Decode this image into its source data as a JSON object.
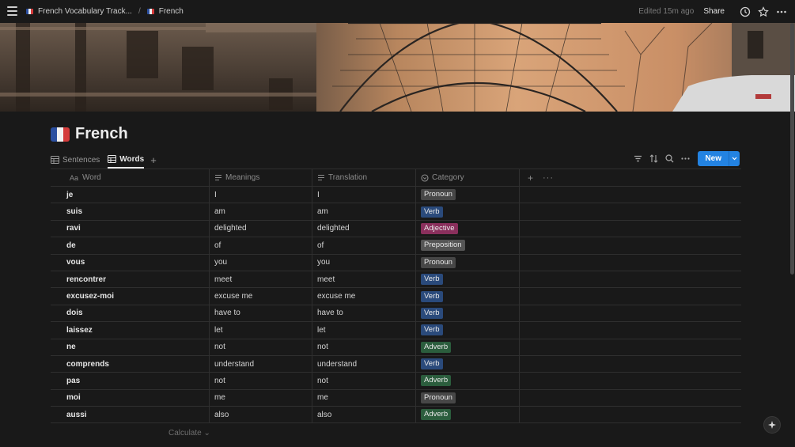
{
  "breadcrumb": {
    "parent": "French Vocabulary Track...",
    "separator": "/",
    "current": "French"
  },
  "topbar": {
    "edited": "Edited 15m ago",
    "share": "Share",
    "icons": [
      "hamburger-icon",
      "clock-icon",
      "star-icon",
      "more-icon"
    ]
  },
  "page": {
    "title": "French",
    "icon": "french-flag"
  },
  "tabs": [
    {
      "label": "Sentences",
      "icon": "table-icon",
      "active": false
    },
    {
      "label": "Words",
      "icon": "table-icon",
      "active": true
    }
  ],
  "toolbar": {
    "new_label": "New"
  },
  "table": {
    "columns": [
      {
        "label": "Word",
        "icon": "Aa"
      },
      {
        "label": "Meanings",
        "icon": "text-icon"
      },
      {
        "label": "Translation",
        "icon": "text-icon"
      },
      {
        "label": "Category",
        "icon": "select-icon"
      }
    ],
    "rows": [
      {
        "word": "je",
        "meaning": "I",
        "translation": "I",
        "category": "Pronoun"
      },
      {
        "word": "suis",
        "meaning": "am",
        "translation": "am",
        "category": "Verb"
      },
      {
        "word": "ravi",
        "meaning": "delighted",
        "translation": "delighted",
        "category": "Adjective"
      },
      {
        "word": "de",
        "meaning": "of",
        "translation": "of",
        "category": "Preposition"
      },
      {
        "word": "vous",
        "meaning": "you",
        "translation": "you",
        "category": "Pronoun"
      },
      {
        "word": "rencontrer",
        "meaning": "meet",
        "translation": "meet",
        "category": "Verb"
      },
      {
        "word": "excusez-moi",
        "meaning": "excuse me",
        "translation": "excuse me",
        "category": "Verb"
      },
      {
        "word": "dois",
        "meaning": "have to",
        "translation": "have to",
        "category": "Verb"
      },
      {
        "word": "laissez",
        "meaning": "let",
        "translation": "let",
        "category": "Verb"
      },
      {
        "word": "ne",
        "meaning": "not",
        "translation": "not",
        "category": "Adverb"
      },
      {
        "word": "comprends",
        "meaning": "understand",
        "translation": "understand",
        "category": "Verb"
      },
      {
        "word": "pas",
        "meaning": "not",
        "translation": "not",
        "category": "Adverb"
      },
      {
        "word": "moi",
        "meaning": "me",
        "translation": "me",
        "category": "Pronoun"
      },
      {
        "word": "aussi",
        "meaning": "also",
        "translation": "also",
        "category": "Adverb"
      }
    ]
  },
  "category_colors": {
    "Pronoun": "#474747",
    "Verb": "#2a4a7b",
    "Adjective": "#8a2f5c",
    "Preposition": "#555555",
    "Adverb": "#2b5d3d"
  },
  "calculate": "Calculate",
  "colors": {
    "accent": "#2383e2",
    "background": "#191919"
  }
}
